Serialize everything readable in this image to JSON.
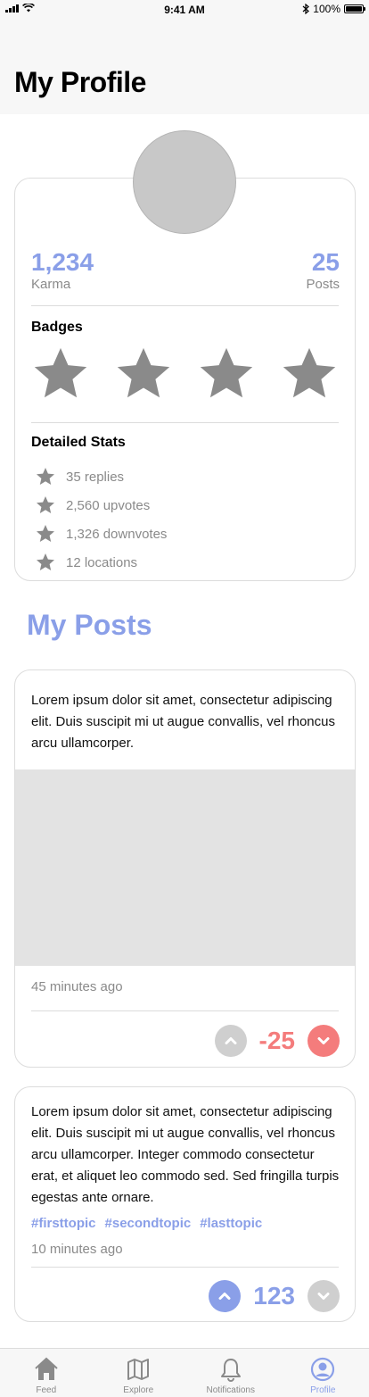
{
  "status_bar": {
    "time": "9:41 AM",
    "battery": "100%",
    "battery_level": 1.0
  },
  "header": {
    "title": "My Profile"
  },
  "profile": {
    "karma": {
      "value": "1,234",
      "label": "Karma"
    },
    "posts": {
      "value": "25",
      "label": "Posts"
    },
    "badges_title": "Badges",
    "badge_count": 4,
    "stats_title": "Detailed Stats",
    "stats": [
      "35 replies",
      "2,560 upvotes",
      "1,326 downvotes",
      "12 locations"
    ]
  },
  "my_posts_title": "My Posts",
  "posts": [
    {
      "text": "Lorem ipsum dolor sit amet, consectetur adipiscing elit. Duis suscipit mi ut augue convallis, vel rhoncus arcu ullamcorper.",
      "time": "45 minutes ago",
      "score": "-25",
      "vote_state": "down"
    },
    {
      "text": "Lorem ipsum dolor sit amet, consectetur adipiscing elit. Duis suscipit mi ut augue convallis, vel rhoncus arcu ullamcorper. Integer commodo consectetur erat, et aliquet leo commodo sed. Sed fringilla turpis egestas ante ornare.",
      "tags": [
        "#firsttopic",
        "#secondtopic",
        "#lasttopic"
      ],
      "time": "10 minutes ago",
      "score": "123",
      "vote_state": "up"
    }
  ],
  "tabbar": {
    "tabs": [
      {
        "label": "Feed",
        "icon": "home-icon"
      },
      {
        "label": "Explore",
        "icon": "map-icon"
      },
      {
        "label": "Notifications",
        "icon": "bell-icon"
      },
      {
        "label": "Profile",
        "icon": "profile-icon",
        "active": true
      }
    ]
  },
  "colors": {
    "accent": "#8a9fe8",
    "downvote": "#f47c7c",
    "neutral": "#cfcfcf",
    "star": "#8a8a8a"
  }
}
